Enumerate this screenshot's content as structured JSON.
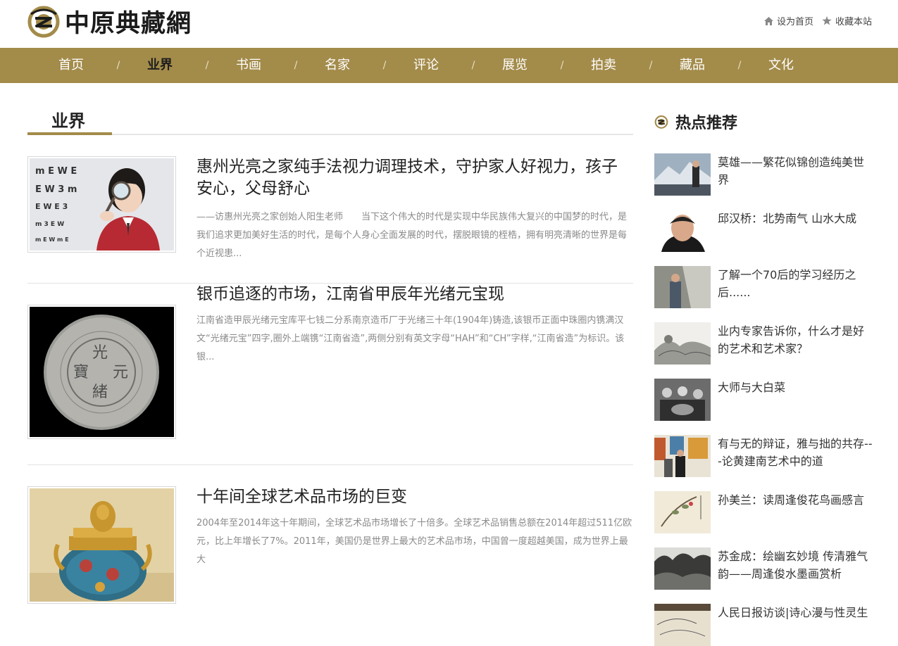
{
  "header": {
    "site_name": "中原典藏網",
    "set_homepage": "设为首页",
    "bookmark": "收藏本站"
  },
  "nav": [
    "首页",
    "业界",
    "书画",
    "名家",
    "评论",
    "展览",
    "拍卖",
    "藏品",
    "文化"
  ],
  "nav_active": "业界",
  "nav_separator": "/",
  "section": {
    "title": "业界"
  },
  "articles": [
    {
      "title": "惠州光亮之家纯手法视力调理技术，守护家人好视力，孩子安心，父母舒心",
      "summary": "——访惠州光亮之家创始人阳生老师　　当下这个伟大的时代是实现中华民族伟大复兴的中国梦的时代，是我们追求更加美好生活的时代，是每个人身心全面发展的时代，摆脱眼镜的桎梏，拥有明亮清晰的世界是每个近视患..."
    },
    {
      "title": "银币追逐的市场，江南省甲辰年光绪元宝现",
      "summary": "江南省造甲辰光绪元宝库平七钱二分系南京造币厂于光绪三十年(1904年)铸造,该银币正面中珠圈内镌满汉文“光绪元宝”四字,圈外上端镌“江南省造”,两侧分别有英文字母“HAH”和“CH”字样,“江南省造”为标识。该银..."
    },
    {
      "title": "十年间全球艺术品市场的巨变",
      "summary": "2004年至2014年这十年期间，全球艺术品市场增长了十倍多。全球艺术品销售总额在2014年超过511亿欧元，比上年增长了7%。2011年，美国仍是世界上最大的艺术品市场，中国曾一度超越美国，成为世界上最大"
    }
  ],
  "sidebar": {
    "title": "热点推荐",
    "items": [
      "莫雄——繁花似锦创造纯美世界",
      "邱汉桥：北势南气 山水大成",
      "了解一个70后的学习经历之后......",
      "业内专家告诉你，什么才是好的艺术和艺术家？",
      "大师与大白菜",
      "有与无的辩证，雅与拙的共存---论黄建南艺术中的道",
      "孙美兰：读周逢俊花鸟画感言",
      "苏金成：绘幽玄妙境 传清雅气韵——周逢俊水墨画赏析",
      "人民日报访谈|诗心漫与性灵生"
    ]
  },
  "colors": {
    "brand_gold": "#a38b4a",
    "text_dark": "#222222",
    "text_muted": "#8a8a8a"
  },
  "icons": [
    "logo-mark",
    "home-icon",
    "star-icon"
  ]
}
